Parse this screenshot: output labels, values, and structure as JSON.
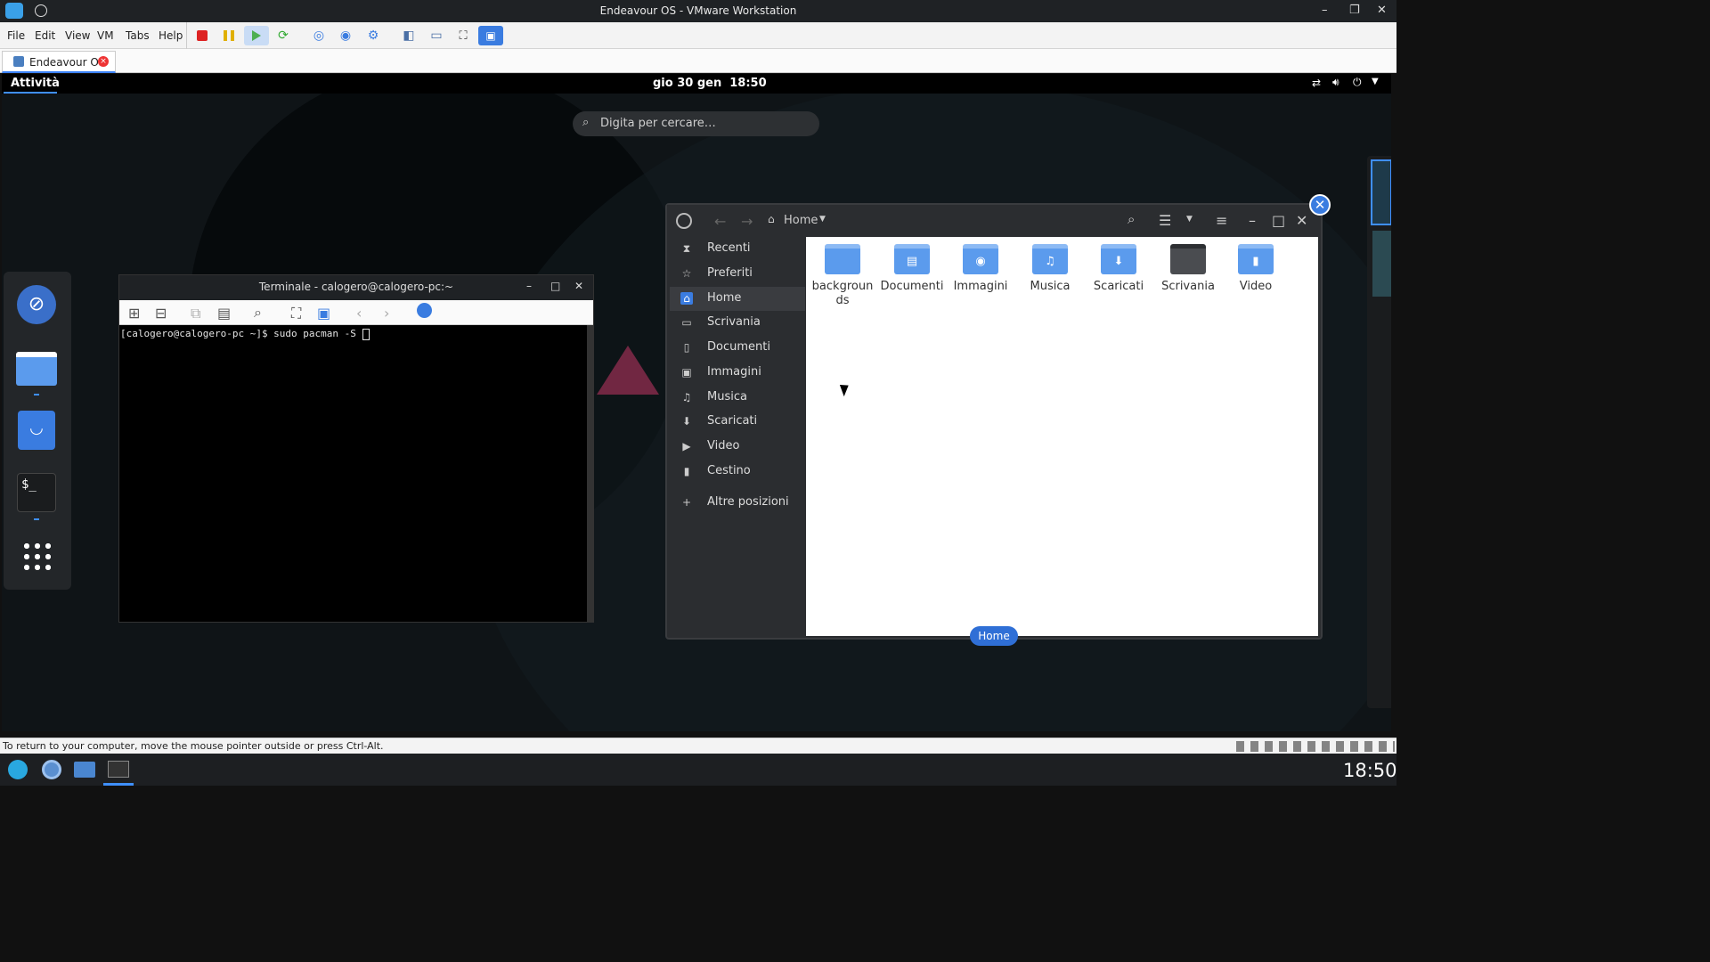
{
  "host": {
    "window_title": "Endeavour OS - VMware Workstation",
    "menu": [
      "File",
      "Edit",
      "View",
      "VM",
      "Tabs",
      "Help"
    ],
    "tab_label": "Endeavour OS",
    "status_text": "To return to your computer, move the mouse pointer outside or press Ctrl-Alt.",
    "clock": "18:50"
  },
  "gnome": {
    "activities": "Attività",
    "datetime": "gio 30 gen  18:50",
    "search_placeholder": "Digita per cercare…"
  },
  "terminal": {
    "title": "Terminale - calogero@calogero-pc:~",
    "prompt_line": "[calogero@calogero-pc ~]$ sudo pacman -S "
  },
  "files": {
    "path_label": "Home",
    "sidebar": [
      {
        "label": "Recenti",
        "icon": "clock-icon"
      },
      {
        "label": "Preferiti",
        "icon": "star-icon"
      },
      {
        "label": "Home",
        "icon": "home-icon",
        "selected": true
      },
      {
        "label": "Scrivania",
        "icon": "desktop-icon"
      },
      {
        "label": "Documenti",
        "icon": "document-icon"
      },
      {
        "label": "Immagini",
        "icon": "image-icon"
      },
      {
        "label": "Musica",
        "icon": "music-icon"
      },
      {
        "label": "Scaricati",
        "icon": "download-icon"
      },
      {
        "label": "Video",
        "icon": "video-icon"
      },
      {
        "label": "Cestino",
        "icon": "trash-icon"
      }
    ],
    "other_locations": "Altre posizioni",
    "folders": [
      {
        "l1": "backgroun",
        "l2": "ds",
        "glyph": ""
      },
      {
        "l1": "Documenti",
        "l2": "",
        "glyph": "doc"
      },
      {
        "l1": "Immagini",
        "l2": "",
        "glyph": "cam"
      },
      {
        "l1": "Musica",
        "l2": "",
        "glyph": "music"
      },
      {
        "l1": "Scaricati",
        "l2": "",
        "glyph": "down"
      },
      {
        "l1": "Scrivania",
        "l2": "",
        "glyph": "desk"
      },
      {
        "l1": "Video",
        "l2": "",
        "glyph": "video"
      }
    ],
    "home_pill": "Home"
  }
}
